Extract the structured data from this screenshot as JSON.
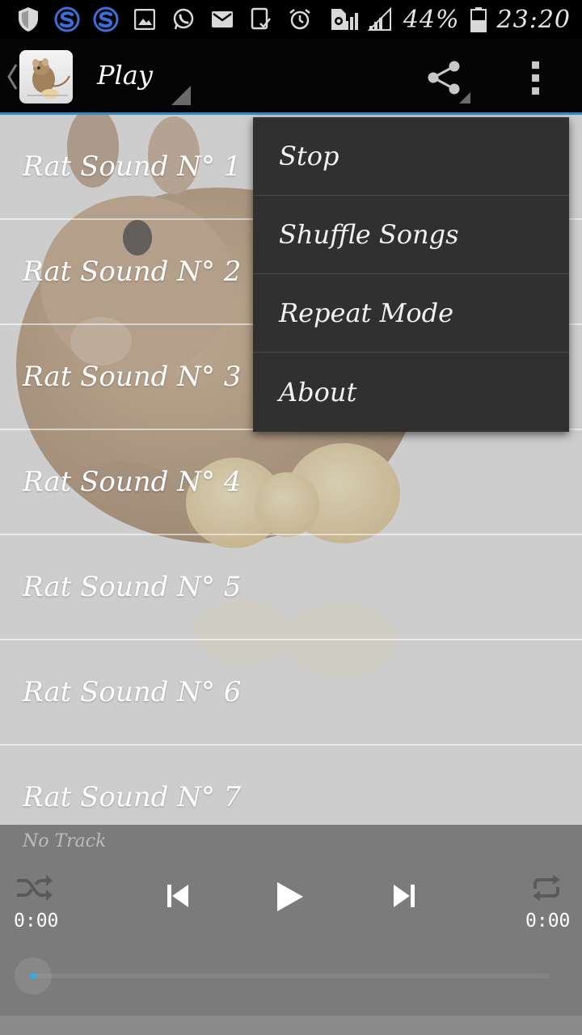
{
  "status_bar": {
    "battery_text": "44%",
    "time": "23:20",
    "icons": [
      "shield-icon",
      "s-app-icon",
      "s-app-icon",
      "gallery-icon",
      "whatsapp-icon",
      "gmail-icon",
      "tasks-icon",
      "alarm-icon",
      "sync-icon",
      "signal-icon",
      "signal-icon",
      "battery-icon"
    ]
  },
  "action_bar": {
    "title": "Play",
    "icons": [
      "back-chevron-icon",
      "app-logo-icon",
      "share-icon",
      "overflow-menu-icon"
    ]
  },
  "list": {
    "items": [
      {
        "label": "Rat Sound N° 1"
      },
      {
        "label": "Rat Sound N° 2"
      },
      {
        "label": "Rat Sound N° 3"
      },
      {
        "label": "Rat Sound N° 4"
      },
      {
        "label": "Rat Sound N° 5"
      },
      {
        "label": "Rat Sound N° 6"
      },
      {
        "label": "Rat Sound N° 7"
      }
    ]
  },
  "menu": {
    "items": [
      {
        "label": "Stop"
      },
      {
        "label": "Shuffle Songs"
      },
      {
        "label": "Repeat Mode"
      },
      {
        "label": "About"
      }
    ]
  },
  "player": {
    "now_playing": "No Track",
    "elapsed": "0:00",
    "duration": "0:00",
    "progress_fraction": 0.0,
    "controls": [
      "shuffle-icon",
      "previous-icon",
      "play-icon",
      "next-icon",
      "repeat-icon"
    ]
  },
  "colors": {
    "accent": "#2f8dc6",
    "progress": "#31a3dc",
    "menu_bg": "#303030",
    "player_bg": "#7b7b7b"
  }
}
